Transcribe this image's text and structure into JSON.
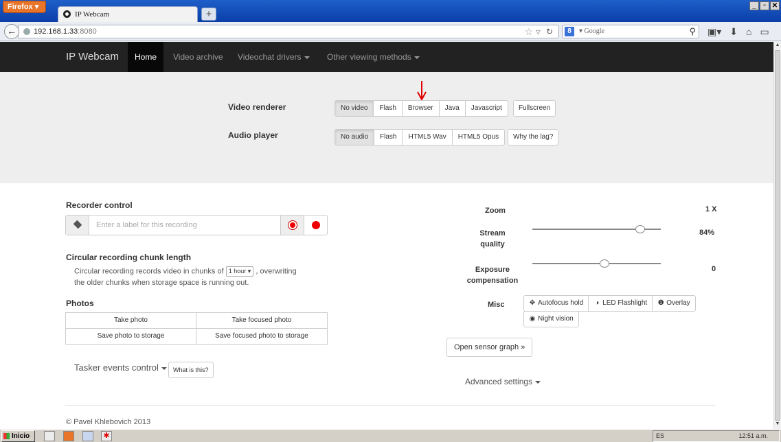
{
  "browser": {
    "menu_label": "Firefox",
    "tab_title": "IP Webcam",
    "new_tab_label": "+",
    "window_buttons": [
      "_",
      "▫",
      "✕"
    ],
    "url_host": "192.168.1.33",
    "url_port": ":8080",
    "search_engine": "Google",
    "search_engine_badge": "8"
  },
  "nav": {
    "brand": "IP Webcam",
    "home": "Home",
    "video_archive": "Video archive",
    "videochat_drivers": "Videochat drivers",
    "other_viewing": "Other viewing methods"
  },
  "renderer": {
    "video_label": "Video renderer",
    "video_options": [
      "No video",
      "Flash",
      "Browser",
      "Java",
      "Javascript"
    ],
    "video_active": "No video",
    "fullscreen": "Fullscreen",
    "audio_label": "Audio player",
    "audio_options": [
      "No audio",
      "Flash",
      "HTML5 Wav",
      "HTML5 Opus"
    ],
    "audio_active": "No audio",
    "lag_help": "Why the lag?",
    "arrow_color": "#e00000"
  },
  "recorder": {
    "heading": "Recorder control",
    "placeholder": "Enter a label for this recording"
  },
  "circular": {
    "heading": "Circular recording chunk length",
    "text_before": "Circular recording records video in chunks of",
    "chunk_value": "1 hour",
    "text_after": ", overwriting",
    "text_line2": "the older chunks when storage space is running out."
  },
  "photos": {
    "heading": "Photos",
    "buttons": [
      "Take photo",
      "Take focused photo",
      "Save photo to storage",
      "Save focused photo to storage"
    ]
  },
  "tasker": {
    "label": "Tasker events control",
    "help": "What is this?"
  },
  "controls": {
    "zoom_label": "Zoom",
    "zoom_value": "1 X",
    "quality_label_1": "Stream",
    "quality_label_2": "quality",
    "quality_value": "84%",
    "quality_fraction": 0.84,
    "exposure_label_1": "Exposure",
    "exposure_label_2": "compensation",
    "exposure_value": "0",
    "exposure_fraction": 0.56,
    "misc_label": "Misc",
    "misc_buttons": [
      "Autofocus hold",
      "LED Flashlight",
      "Overlay",
      "Night vision"
    ],
    "misc_icons": [
      "crosshair-icon",
      "half-circle-icon",
      "info-icon",
      "eye-icon"
    ]
  },
  "sensor_graph": "Open sensor graph »",
  "advanced": "Advanced settings",
  "footer": "© Pavel Khlebovich 2013",
  "taskbar": {
    "start": "Inicio",
    "lang": "ES",
    "clock": "12:51 a.m."
  }
}
